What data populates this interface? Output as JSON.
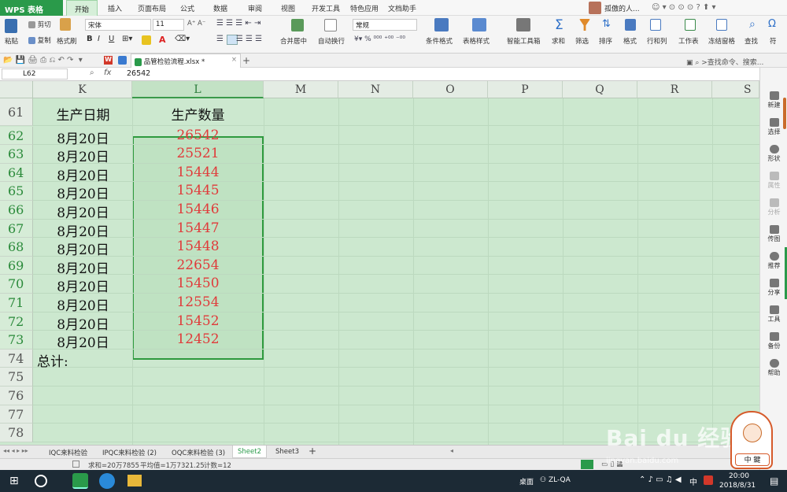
{
  "menu": {
    "app": "WPS 表格",
    "tabs": [
      "开始",
      "插入",
      "页面布局",
      "公式",
      "数据",
      "审阅",
      "视图",
      "开发工具",
      "特色应用",
      "文档助手"
    ],
    "user": "孤傲的人..."
  },
  "ribbon": {
    "paste": "粘贴",
    "cut": "剪切",
    "copy": "复制",
    "format_painter": "格式刷",
    "font_name": "宋体",
    "font_size": "11",
    "merge_center": "合并居中",
    "wrap": "自动换行",
    "number_format": "常规",
    "cond_format": "条件格式",
    "table_style": "表格样式",
    "smart_toolbox": "智能工具箱",
    "sum": "求和",
    "filter": "筛选",
    "sort": "排序",
    "format": "格式",
    "rows_cols": "行和列",
    "worksheet": "工作表",
    "freeze": "冻结窗格",
    "find": "查找",
    "symbol": "符"
  },
  "quickbar": {
    "file_tab": "品管检验流程.xlsx *",
    "search": ">查找命令、搜索..."
  },
  "formula_bar": {
    "name_box": "L62",
    "fx": "fx",
    "value": "26542"
  },
  "columns": [
    "K",
    "L",
    "M",
    "N",
    "O",
    "P",
    "Q",
    "R",
    "S"
  ],
  "rows": [
    {
      "num": "61",
      "k": "生产日期",
      "l": "生产数量"
    },
    {
      "num": "62",
      "k": "8月20日",
      "l": "26542"
    },
    {
      "num": "63",
      "k": "8月20日",
      "l": "25521"
    },
    {
      "num": "64",
      "k": "8月20日",
      "l": "15444"
    },
    {
      "num": "65",
      "k": "8月20日",
      "l": "15445"
    },
    {
      "num": "66",
      "k": "8月20日",
      "l": "15446"
    },
    {
      "num": "67",
      "k": "8月20日",
      "l": "15447"
    },
    {
      "num": "68",
      "k": "8月20日",
      "l": "15448"
    },
    {
      "num": "69",
      "k": "8月20日",
      "l": "22654"
    },
    {
      "num": "70",
      "k": "8月20日",
      "l": "15450"
    },
    {
      "num": "71",
      "k": "8月20日",
      "l": "12554"
    },
    {
      "num": "72",
      "k": "8月20日",
      "l": "15452"
    },
    {
      "num": "73",
      "k": "8月20日",
      "l": "12452"
    },
    {
      "num": "74",
      "k": "总计:",
      "l": ""
    },
    {
      "num": "75",
      "k": "",
      "l": ""
    },
    {
      "num": "76",
      "k": "",
      "l": ""
    },
    {
      "num": "77",
      "k": "",
      "l": ""
    },
    {
      "num": "78",
      "k": "",
      "l": ""
    }
  ],
  "sheets": [
    "IQC来料检验",
    "IPQC来料检验 (2)",
    "OQC来料检验 (3)",
    "Sheet2",
    "Sheet3"
  ],
  "active_sheet": "Sheet2",
  "status": {
    "sum": "求和=20万7855",
    "avg": "平均值=1万7321.25",
    "count": "计数=12"
  },
  "right_panel": [
    "新建",
    "选择",
    "形状",
    "属性",
    "分析",
    "传图",
    "推荐",
    "分享",
    "工具",
    "备份",
    "帮助"
  ],
  "taskbar": {
    "desktop": "桌面",
    "user": "ZL-QA",
    "ime": "中",
    "time": "20:00",
    "date": "2018/8/31"
  },
  "watermark": {
    "logo": "Bai du 经验",
    "url": "jingyan.baidu.com"
  },
  "colors": {
    "accent": "#2a9a4a",
    "grid_bg": "#cce8cf",
    "value_red": "#e03a3a"
  }
}
